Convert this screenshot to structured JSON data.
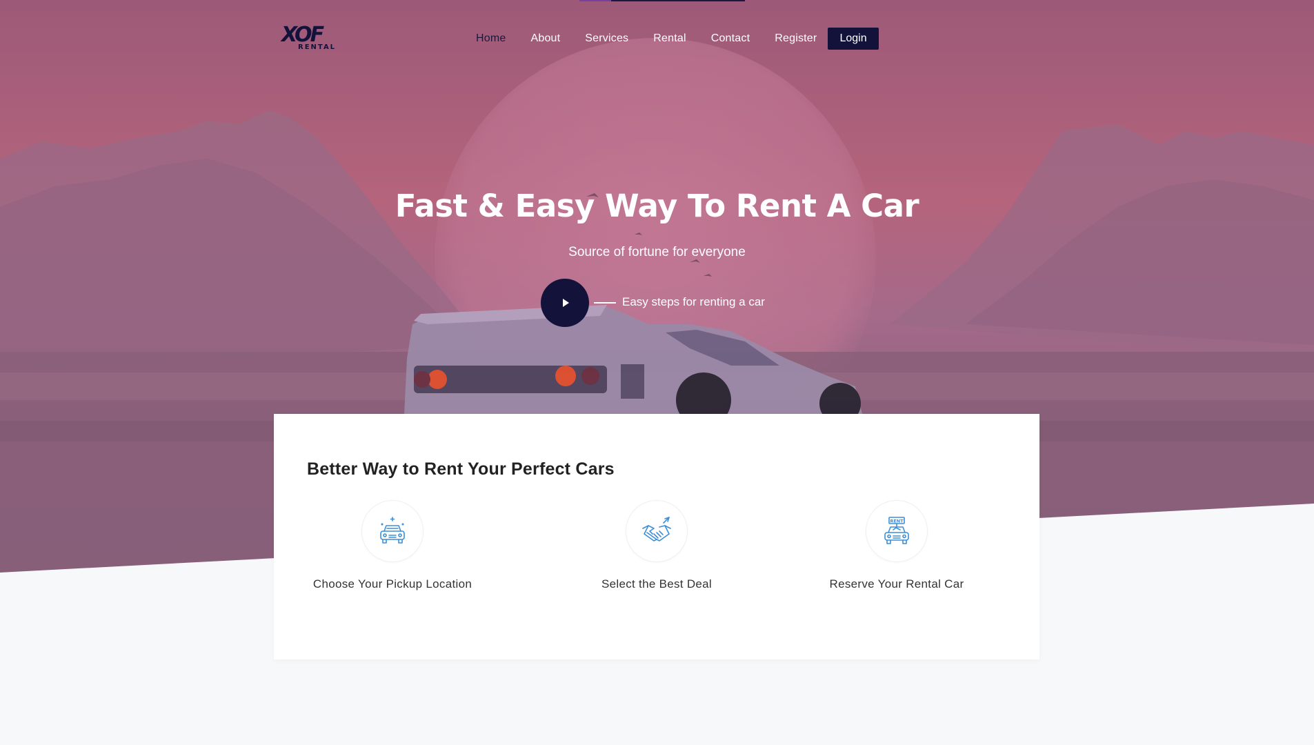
{
  "nav": {
    "logo_mark": "XOF",
    "logo_sub": "RENTAL",
    "items": [
      {
        "label": "Home"
      },
      {
        "label": "About"
      },
      {
        "label": "Services"
      },
      {
        "label": "Rental"
      },
      {
        "label": "Contact"
      },
      {
        "label": "Register"
      }
    ],
    "login_label": "Login"
  },
  "hero": {
    "title": "Fast & Easy Way To Rent A Car",
    "subtitle": "Source of fortune for everyone",
    "steps_label": "Easy steps for renting a car"
  },
  "features": {
    "title": "Better Way to Rent Your Perfect Cars",
    "items": [
      {
        "label": "Choose Your Pickup Location",
        "icon": "car-location-icon"
      },
      {
        "label": "Select the Best Deal",
        "icon": "handshake-icon"
      },
      {
        "label": "Reserve Your Rental Car",
        "icon": "rent-car-icon"
      }
    ],
    "rent_sign": "RENT"
  },
  "colors": {
    "brand": "#13123b",
    "icon_blue": "#3a8fd8",
    "hero_pink": "#b5647c"
  }
}
